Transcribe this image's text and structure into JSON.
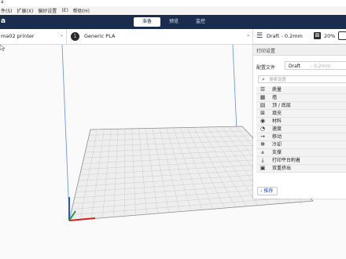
{
  "title_bar": {
    "text": "a"
  },
  "menu": {
    "items": [
      "件(S)",
      "扩展(X)",
      "偏好设置",
      "(E)",
      "帮助(H)"
    ]
  },
  "app": {
    "logo": "a"
  },
  "stages": [
    {
      "label": "准备",
      "active": true
    },
    {
      "label": "预览",
      "active": false
    },
    {
      "label": "监控",
      "active": false
    }
  ],
  "printer": {
    "name": "ma02 printer"
  },
  "material": {
    "extruder": "1",
    "name": "Generic PLA"
  },
  "print_summary": {
    "profile": "Draft - 0.2mm",
    "infill": "20%"
  },
  "settings_panel": {
    "title": "打印设置",
    "profile_label": "配置文件",
    "profile_value": "Draft",
    "profile_value_detail": "- 0.2mm",
    "search_placeholder": "搜索设置",
    "categories": [
      {
        "icon": "quality-icon",
        "glyph": "☰",
        "label": "质量"
      },
      {
        "icon": "wall-icon",
        "glyph": "▦",
        "label": "墙"
      },
      {
        "icon": "top-bottom-icon",
        "glyph": "▤",
        "label": "顶 / 底层"
      },
      {
        "icon": "infill-icon",
        "glyph": "⊠",
        "label": "填充"
      },
      {
        "icon": "material-icon",
        "glyph": "◉",
        "label": "材料"
      },
      {
        "icon": "speed-icon",
        "glyph": "◔",
        "label": "速度"
      },
      {
        "icon": "travel-icon",
        "glyph": "⇝",
        "label": "移动"
      },
      {
        "icon": "cooling-icon",
        "glyph": "✻",
        "label": "冷却"
      },
      {
        "icon": "support-icon",
        "glyph": "⩓",
        "label": "支撑"
      },
      {
        "icon": "adhesion-icon",
        "glyph": "⤓",
        "label": "打印平台附着"
      },
      {
        "icon": "dual-extrusion-icon",
        "glyph": "▣",
        "label": "双重挤出"
      }
    ],
    "back_label": "‹ 推荐"
  },
  "colors": {
    "topbar": "#1a2d4f",
    "accent": "#2a56c6",
    "axis_x": "#d62020",
    "axis_y": "#1fa32a",
    "axis_z": "#2255dd"
  }
}
